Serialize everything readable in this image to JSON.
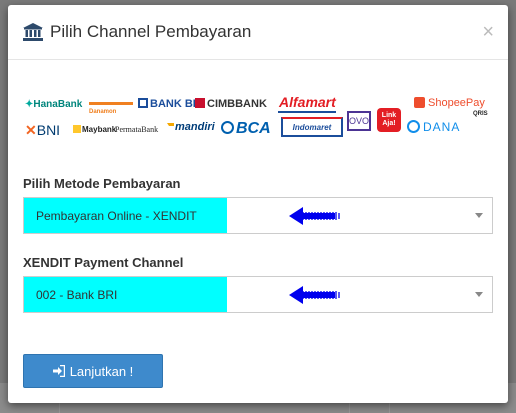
{
  "modal": {
    "title": "Pilih Channel Pembayaran",
    "close_label": "×"
  },
  "logos": {
    "hana": "HanaBank",
    "danamon": "Danamon",
    "bri": "BANK BRI",
    "cimb": "CIMBBANK",
    "alfamart": "Alfamart",
    "shopeepay": "ShopeePay",
    "qris": "QRIS",
    "bni": "BNI",
    "maybank": "Maybank",
    "permata": "PermataBank",
    "mandiri": "mandiri",
    "bca": "BCA",
    "indomaret": "Indomaret",
    "ovo": "OVO",
    "linkaja": "Link Aja!",
    "dana": "DANA"
  },
  "method": {
    "label": "Pilih Metode Pembayaran",
    "selected": "Pembayaran Online - XENDIT"
  },
  "channel": {
    "label": "XENDIT Payment Channel",
    "selected": "002 - Bank BRI"
  },
  "submit": {
    "label": "Lanjutkan !"
  },
  "colors": {
    "highlight": "#00ffff",
    "arrow": "#0000ee",
    "button": "#3e8acc"
  }
}
